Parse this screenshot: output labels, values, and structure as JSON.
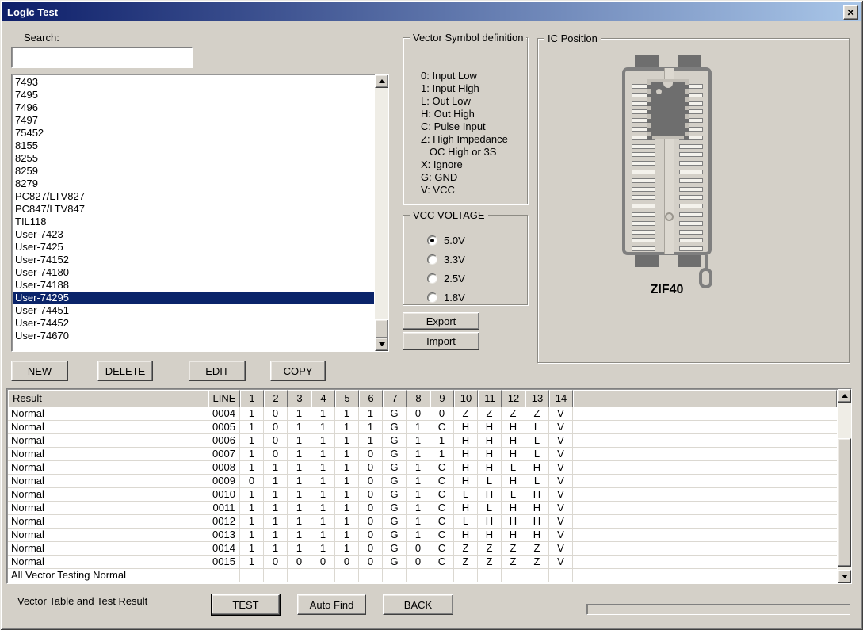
{
  "window": {
    "title": "Logic Test",
    "close_icon": "✕"
  },
  "search": {
    "label": "Search:",
    "value": ""
  },
  "device_list": {
    "items": [
      "7493",
      "7495",
      "7496",
      "7497",
      "75452",
      "8155",
      "8255",
      "8259",
      "8279",
      "PC827/LTV827",
      "PC847/LTV847",
      "TIL118",
      "User-7423",
      "User-7425",
      "User-74152",
      "User-74180",
      "User-74188",
      "User-74295",
      "User-74451",
      "User-74452",
      "User-74670"
    ],
    "selected": "User-74295",
    "selected_index": 17
  },
  "list_buttons": {
    "new": "NEW",
    "delete": "DELETE",
    "edit": "EDIT",
    "copy": "COPY"
  },
  "vector_symbols": {
    "title": "Vector Symbol definition",
    "lines": [
      "0: Input Low",
      "1: Input High",
      "L: Out Low",
      "H: Out High",
      "C: Pulse Input",
      "Z: High Impedance",
      "   OC High or 3S",
      "X: Ignore",
      "G: GND",
      "V: VCC"
    ]
  },
  "vcc_voltage": {
    "title": "VCC VOLTAGE",
    "options": [
      {
        "label": "5.0V",
        "selected": true
      },
      {
        "label": "3.3V",
        "selected": false
      },
      {
        "label": "2.5V",
        "selected": false
      },
      {
        "label": "1.8V",
        "selected": false
      }
    ]
  },
  "io_buttons": {
    "export": "Export",
    "import": "Import"
  },
  "ic_position": {
    "title": "IC Position",
    "socket_label": "ZIF40",
    "pins_per_side": 20,
    "chip_pin_rows": 7
  },
  "vector_table": {
    "columns": [
      "Result",
      "LINE",
      "1",
      "2",
      "3",
      "4",
      "5",
      "6",
      "7",
      "8",
      "9",
      "10",
      "11",
      "12",
      "13",
      "14"
    ],
    "rows": [
      {
        "result": "Normal",
        "line": "0004",
        "values": [
          "1",
          "0",
          "1",
          "1",
          "1",
          "1",
          "G",
          "0",
          "0",
          "Z",
          "Z",
          "Z",
          "Z",
          "V"
        ]
      },
      {
        "result": "Normal",
        "line": "0005",
        "values": [
          "1",
          "0",
          "1",
          "1",
          "1",
          "1",
          "G",
          "1",
          "C",
          "H",
          "H",
          "H",
          "L",
          "V"
        ]
      },
      {
        "result": "Normal",
        "line": "0006",
        "values": [
          "1",
          "0",
          "1",
          "1",
          "1",
          "1",
          "G",
          "1",
          "1",
          "H",
          "H",
          "H",
          "L",
          "V"
        ]
      },
      {
        "result": "Normal",
        "line": "0007",
        "values": [
          "1",
          "0",
          "1",
          "1",
          "1",
          "0",
          "G",
          "1",
          "1",
          "H",
          "H",
          "H",
          "L",
          "V"
        ]
      },
      {
        "result": "Normal",
        "line": "0008",
        "values": [
          "1",
          "1",
          "1",
          "1",
          "1",
          "0",
          "G",
          "1",
          "C",
          "H",
          "H",
          "L",
          "H",
          "V"
        ]
      },
      {
        "result": "Normal",
        "line": "0009",
        "values": [
          "0",
          "1",
          "1",
          "1",
          "1",
          "0",
          "G",
          "1",
          "C",
          "H",
          "L",
          "H",
          "L",
          "V"
        ]
      },
      {
        "result": "Normal",
        "line": "0010",
        "values": [
          "1",
          "1",
          "1",
          "1",
          "1",
          "0",
          "G",
          "1",
          "C",
          "L",
          "H",
          "L",
          "H",
          "V"
        ]
      },
      {
        "result": "Normal",
        "line": "0011",
        "values": [
          "1",
          "1",
          "1",
          "1",
          "1",
          "0",
          "G",
          "1",
          "C",
          "H",
          "L",
          "H",
          "H",
          "V"
        ]
      },
      {
        "result": "Normal",
        "line": "0012",
        "values": [
          "1",
          "1",
          "1",
          "1",
          "1",
          "0",
          "G",
          "1",
          "C",
          "L",
          "H",
          "H",
          "H",
          "V"
        ]
      },
      {
        "result": "Normal",
        "line": "0013",
        "values": [
          "1",
          "1",
          "1",
          "1",
          "1",
          "0",
          "G",
          "1",
          "C",
          "H",
          "H",
          "H",
          "H",
          "V"
        ]
      },
      {
        "result": "Normal",
        "line": "0014",
        "values": [
          "1",
          "1",
          "1",
          "1",
          "1",
          "0",
          "G",
          "0",
          "C",
          "Z",
          "Z",
          "Z",
          "Z",
          "V"
        ]
      },
      {
        "result": "Normal",
        "line": "0015",
        "values": [
          "1",
          "0",
          "0",
          "0",
          "0",
          "0",
          "G",
          "0",
          "C",
          "Z",
          "Z",
          "Z",
          "Z",
          "V"
        ]
      }
    ],
    "footer_text": "All Vector Testing Normal"
  },
  "footer": {
    "label": "Vector Table and Test Result",
    "test": "TEST",
    "auto_find": "Auto Find",
    "back": "BACK"
  },
  "colors": {
    "face": "#d4d0c8",
    "selection": "#0a246a",
    "title_gradient_left": "#0d1e69",
    "title_gradient_right": "#a9c6e8"
  }
}
